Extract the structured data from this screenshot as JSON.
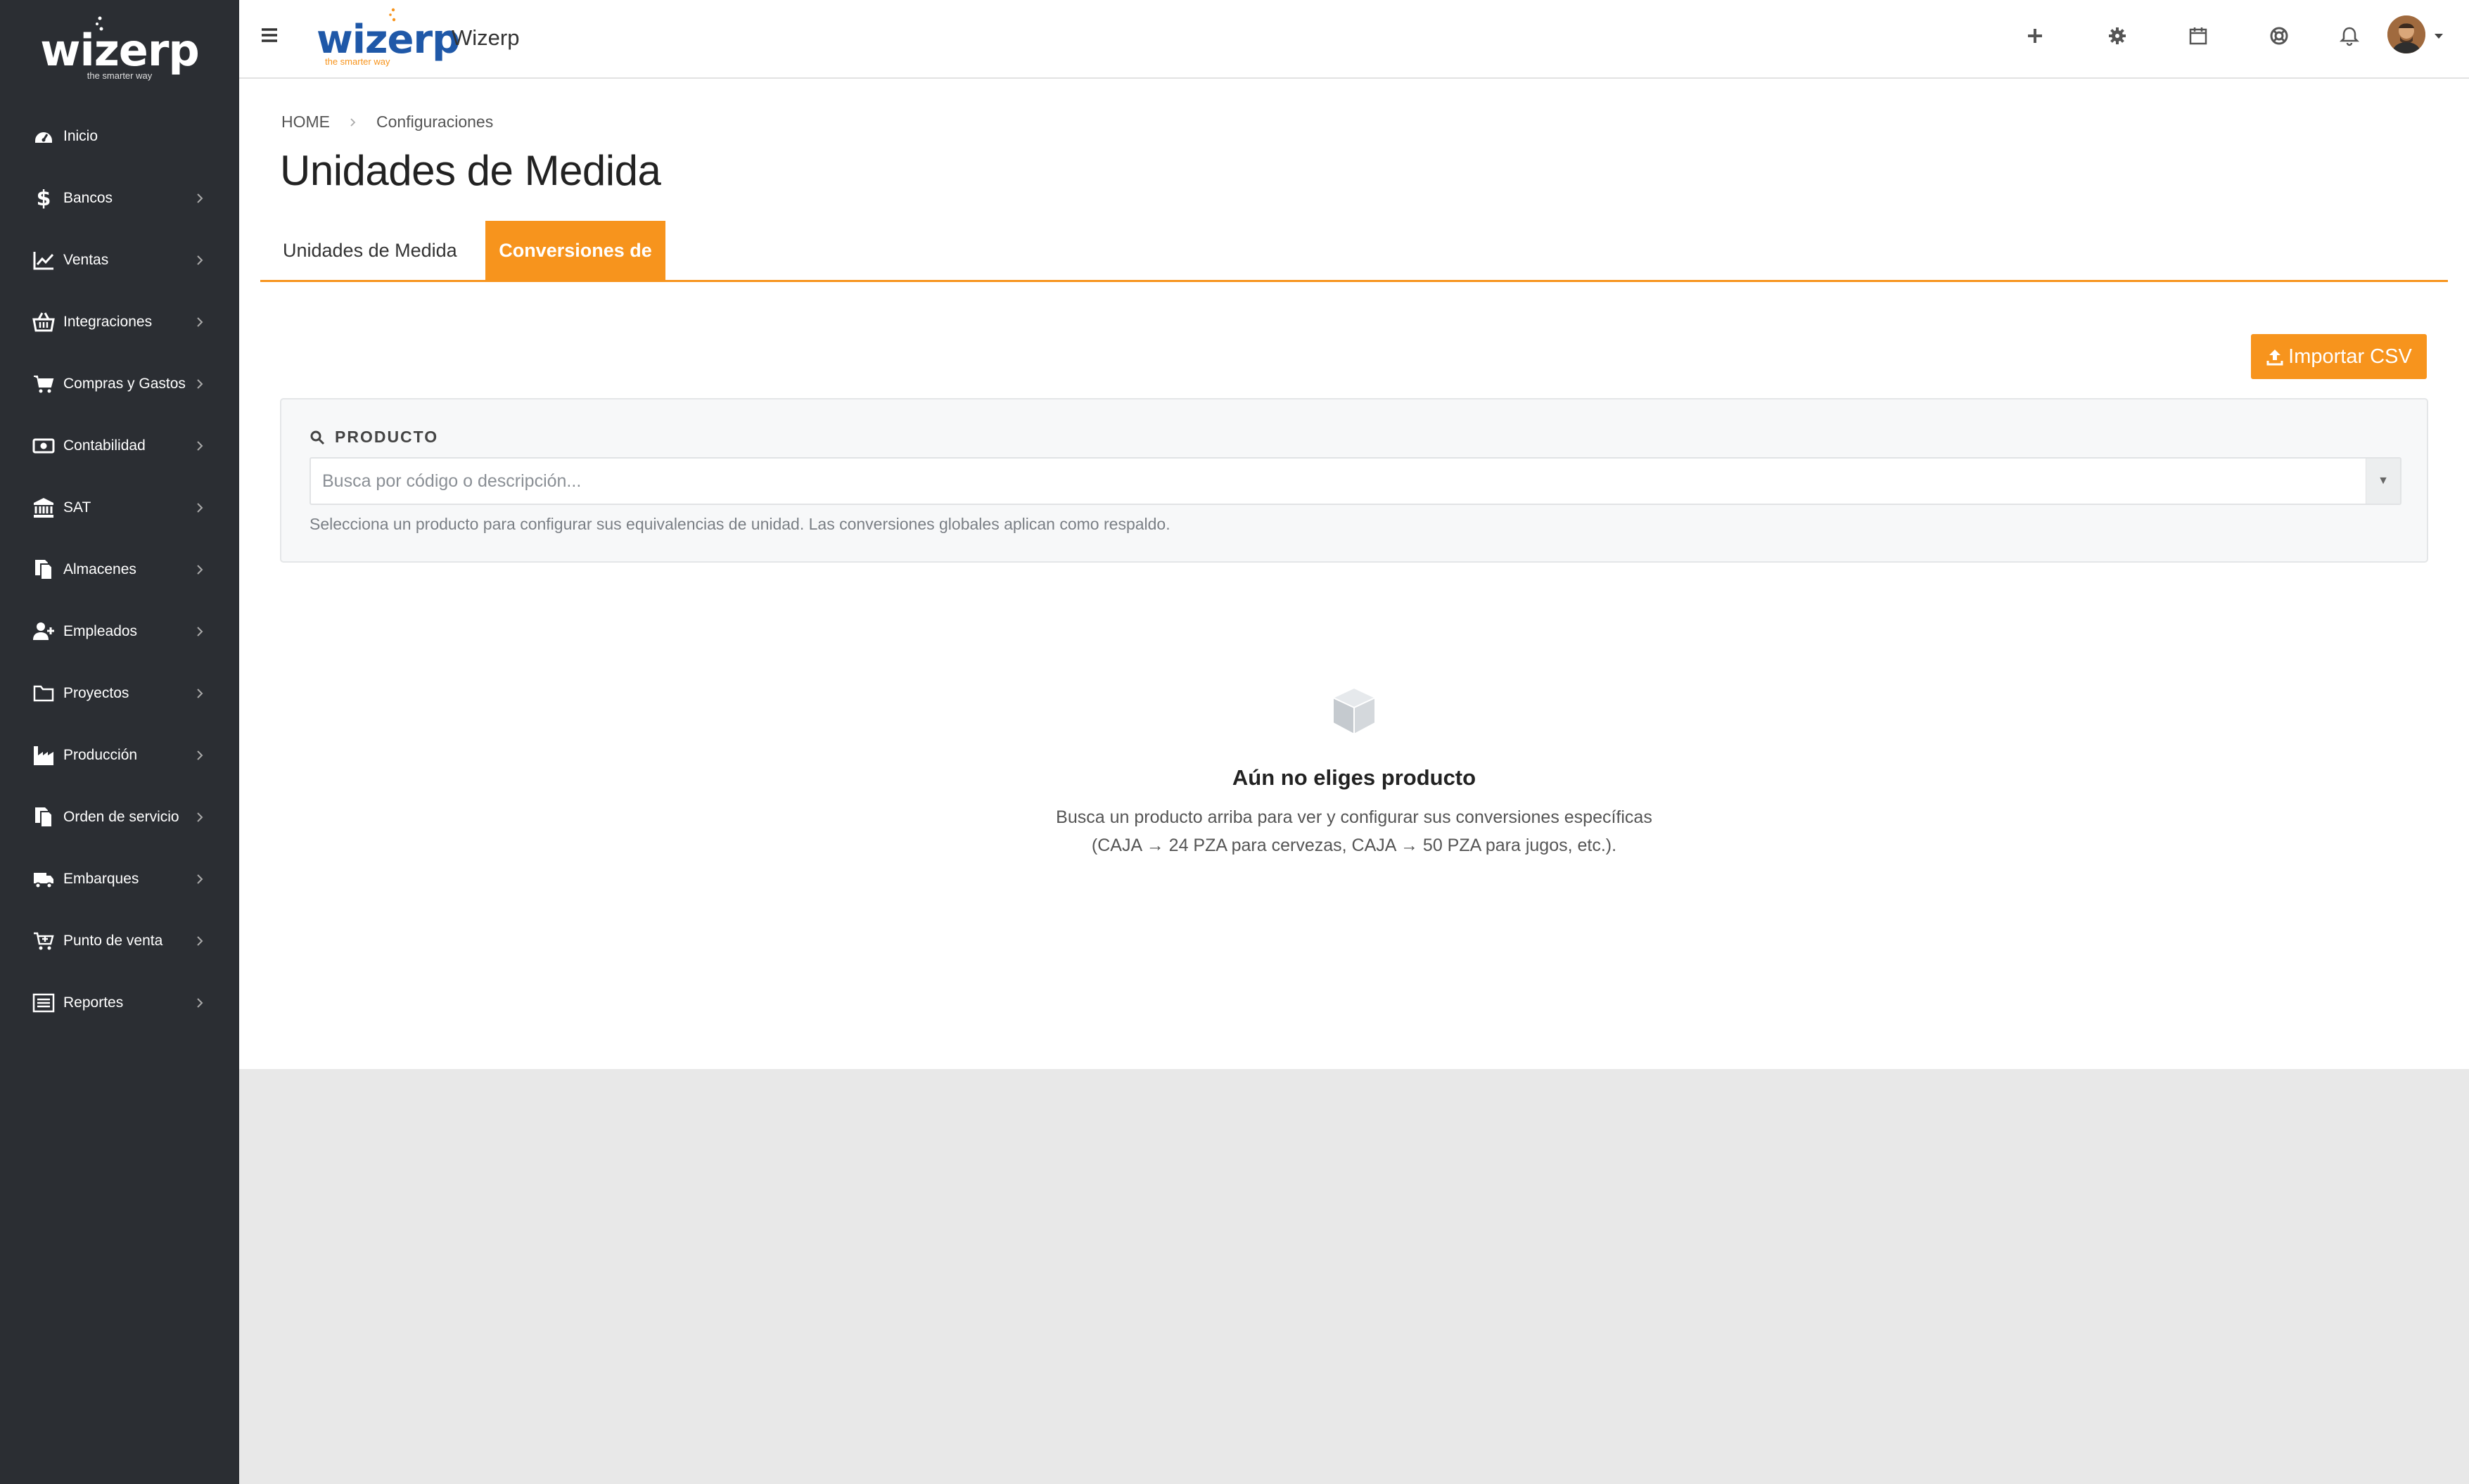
{
  "brand": {
    "name": "wizerp",
    "tagline": "the smarter way",
    "accent": "#f7941d",
    "blue": "#1f58a8"
  },
  "sidebar": {
    "items": [
      {
        "label": "Inicio",
        "icon": "dashboard-icon",
        "submenu": false
      },
      {
        "label": "Bancos",
        "icon": "dollar-icon",
        "submenu": true
      },
      {
        "label": "Ventas",
        "icon": "line-chart-icon",
        "submenu": true
      },
      {
        "label": "Integraciones",
        "icon": "basket-icon",
        "submenu": true
      },
      {
        "label": "Compras y Gastos",
        "icon": "cart-icon",
        "submenu": true
      },
      {
        "label": "Contabilidad",
        "icon": "money-icon",
        "submenu": true
      },
      {
        "label": "SAT",
        "icon": "bank-icon",
        "submenu": true
      },
      {
        "label": "Almacenes",
        "icon": "copy-icon",
        "submenu": true
      },
      {
        "label": "Empleados",
        "icon": "user-plus-icon",
        "submenu": true
      },
      {
        "label": "Proyectos",
        "icon": "folder-icon",
        "submenu": true
      },
      {
        "label": "Producción",
        "icon": "industry-icon",
        "submenu": true
      },
      {
        "label": "Orden de servicio",
        "icon": "clipboard-icon",
        "submenu": true
      },
      {
        "label": "Embarques",
        "icon": "truck-icon",
        "submenu": true
      },
      {
        "label": "Punto de venta",
        "icon": "cart-plus-icon",
        "submenu": true
      },
      {
        "label": "Reportes",
        "icon": "list-icon",
        "submenu": true
      }
    ]
  },
  "topbar": {
    "app_title": "Wizerp",
    "icons": [
      "plus-icon",
      "gear-icon",
      "calendar-icon",
      "support-icon",
      "bell-icon"
    ]
  },
  "breadcrumb": {
    "home": "HOME",
    "current": "Configuraciones"
  },
  "page": {
    "title": "Unidades de Medida"
  },
  "tabs": [
    {
      "label": "Unidades de Medida",
      "active": false
    },
    {
      "label": "Conversiones de Medida",
      "active": true
    }
  ],
  "actions": {
    "import_label": "Importar CSV"
  },
  "product_filter": {
    "label": "PRODUCTO",
    "placeholder": "Busca por código o descripción...",
    "help": "Selecciona un producto para configurar sus equivalencias de unidad. Las conversiones globales aplican como respaldo."
  },
  "empty_state": {
    "title": "Aún no eliges producto",
    "line1": "Busca un producto arriba para ver y configurar sus conversiones específicas",
    "line2": "(CAJA → 24 PZA para cervezas, CAJA → 50 PZA para jugos, etc.)."
  }
}
